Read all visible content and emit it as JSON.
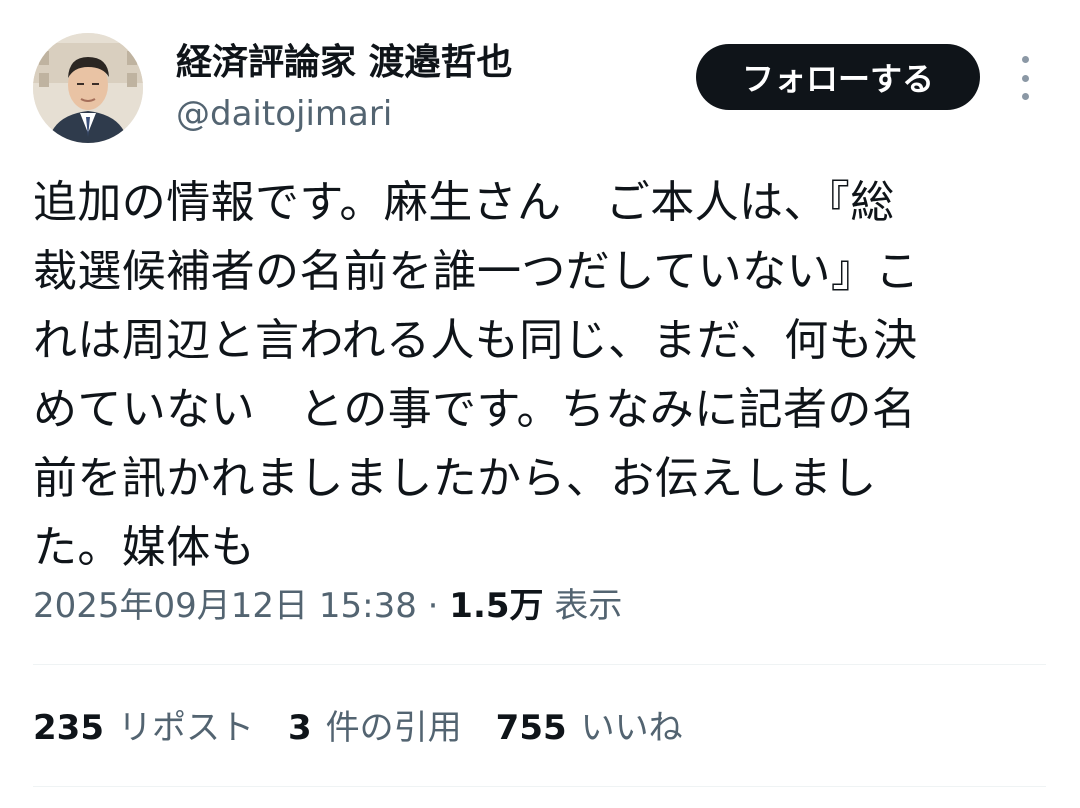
{
  "author": {
    "display_name": "経済評論家 渡邉哲也",
    "handle": "@daitojimari"
  },
  "follow_label": "フォローする",
  "more_icon": "more-vertical-icon",
  "tweet": {
    "lines": [
      "追加の情報です。麻生さん　ご本人は、『総",
      "裁選候補者の名前を誰一つだしていない』こ",
      "れは周辺と言われる人も同じ、まだ、何も決",
      "めていない　との事です。ちなみに記者の名",
      "前を訊かれましましたから、お伝えしまし",
      "た。媒体も"
    ]
  },
  "meta": {
    "timestamp": "2025年09月12日 15:38",
    "separator": "·",
    "views_count": "1.5万",
    "views_label": "表示"
  },
  "stats": {
    "reposts_count": "235",
    "reposts_label": "リポスト",
    "quotes_count": "3",
    "quotes_label": "件の引用",
    "likes_count": "755",
    "likes_label": "いいね"
  },
  "colors": {
    "text_primary": "#0f1419",
    "text_secondary": "#536471",
    "divider": "#eff3f4",
    "button_bg": "#0f1419",
    "button_text": "#ffffff"
  }
}
